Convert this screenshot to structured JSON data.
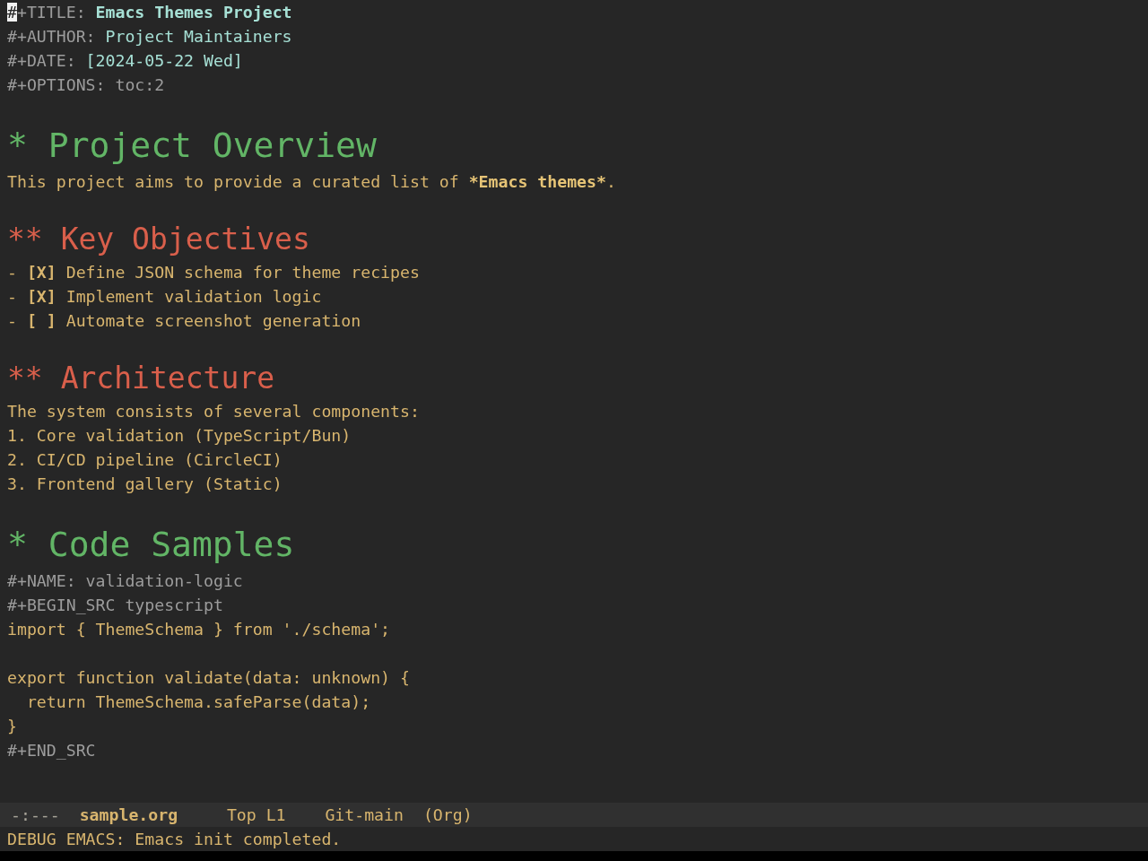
{
  "keywords": [
    {
      "key": "#+TITLE:",
      "value": "Emacs Themes Project",
      "kind": "title",
      "cursor": true
    },
    {
      "key": "#+AUTHOR:",
      "value": "Project Maintainers",
      "kind": "info",
      "cursor": false
    },
    {
      "key": "#+DATE:",
      "value": "[2024-05-22 Wed]",
      "kind": "info",
      "cursor": false
    },
    {
      "key": "#+OPTIONS:",
      "value": "toc:2",
      "kind": "option",
      "cursor": false
    }
  ],
  "outline": [
    {
      "bullet": "*",
      "title": "Project Overview",
      "body": [
        {
          "kind": "paragraph",
          "segments": [
            {
              "text": "This project aims to provide a curated list of ",
              "bold": false
            },
            {
              "text": "*Emacs themes*",
              "bold": true
            },
            {
              "text": ".",
              "bold": false
            }
          ]
        }
      ],
      "children": [
        {
          "bullet": "**",
          "title": "Key Objectives",
          "body": [
            {
              "kind": "checklist",
              "items": [
                {
                  "dash": "-",
                  "box": "[X]",
                  "text": "Define JSON schema for theme recipes"
                },
                {
                  "dash": "-",
                  "box": "[X]",
                  "text": "Implement validation logic"
                },
                {
                  "dash": "-",
                  "box": "[ ]",
                  "text": "Automate screenshot generation"
                }
              ]
            }
          ]
        },
        {
          "bullet": "**",
          "title": "Architecture",
          "body": [
            {
              "kind": "paragraph",
              "segments": [
                {
                  "text": "The system consists of several components:",
                  "bold": false
                }
              ]
            },
            {
              "kind": "numbered",
              "items": [
                {
                  "number": "1.",
                  "text": "Core validation (TypeScript/Bun)"
                },
                {
                  "number": "2.",
                  "text": "CI/CD pipeline (CircleCI)"
                },
                {
                  "number": "3.",
                  "text": "Frontend gallery (Static)"
                }
              ]
            }
          ]
        }
      ]
    },
    {
      "bullet": "*",
      "title": "Code Samples",
      "body": [
        {
          "kind": "keyword",
          "key": "#+NAME:",
          "value": "validation-logic"
        },
        {
          "kind": "src",
          "begin": "#+BEGIN_SRC",
          "language": "typescript",
          "code": [
            [
              "import { ThemeSchema } from './schema';"
            ],
            [
              "export function validate(data: unknown) {",
              "  return ThemeSchema.safeParse(data);",
              "}"
            ]
          ],
          "end": "#+END_SRC"
        }
      ]
    }
  ],
  "mode_line": {
    "flags": "-:---",
    "buffer": "sample.org",
    "position": "Top L1",
    "branch": "Git-main",
    "mode": "(Org)"
  },
  "echo_area": {
    "message": "DEBUG EMACS: Emacs init completed."
  }
}
